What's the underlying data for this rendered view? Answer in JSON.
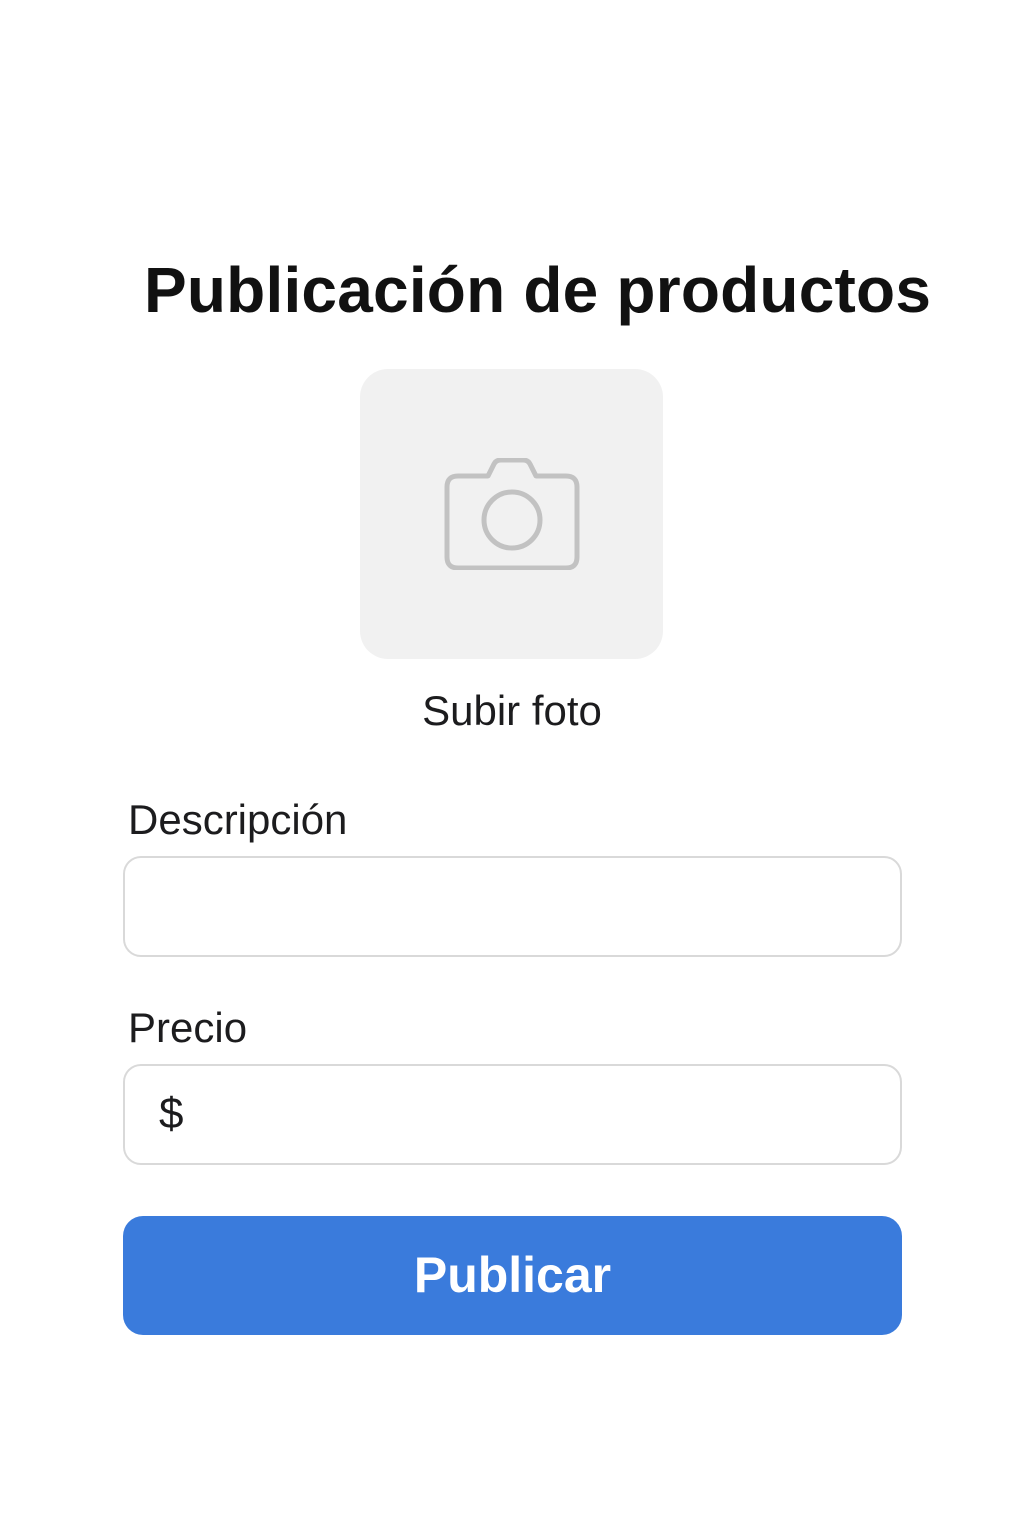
{
  "page": {
    "title": "Publicación de productos"
  },
  "photo_upload": {
    "icon": "camera-icon",
    "label": "Subir foto"
  },
  "form": {
    "description": {
      "label": "Descripción",
      "value": "",
      "placeholder": ""
    },
    "price": {
      "label": "Precio",
      "currency_symbol": "$",
      "value": "",
      "placeholder": ""
    },
    "submit_label": "Publicar"
  },
  "colors": {
    "accent": "#3a7bdc",
    "photo_box_bg": "#f1f1f1",
    "field_border": "#d9d9d9",
    "icon_gray": "#c2c2c2"
  }
}
